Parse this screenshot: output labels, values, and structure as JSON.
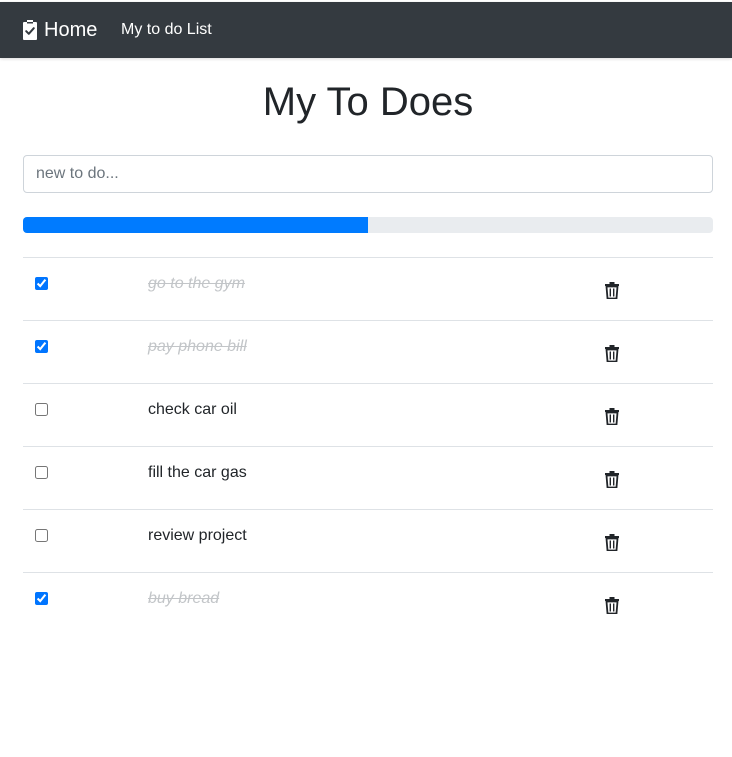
{
  "navbar": {
    "brand_label": "Home",
    "brand_icon": "clipboard-check-icon",
    "nav_link_label": "My to do List",
    "background": "#343a40"
  },
  "main": {
    "title": "My To Does",
    "new_todo": {
      "placeholder": "new to do...",
      "value": ""
    },
    "progress": {
      "fraction": 0.5,
      "color": "#007bff"
    },
    "todos": [
      {
        "text": "go to the gym",
        "done": true
      },
      {
        "text": "pay phone bill",
        "done": true
      },
      {
        "text": "check car oil",
        "done": false
      },
      {
        "text": "fill the car gas",
        "done": false
      },
      {
        "text": "review project",
        "done": false
      },
      {
        "text": "buy bread",
        "done": true
      }
    ],
    "delete_icon": "trash-icon"
  }
}
